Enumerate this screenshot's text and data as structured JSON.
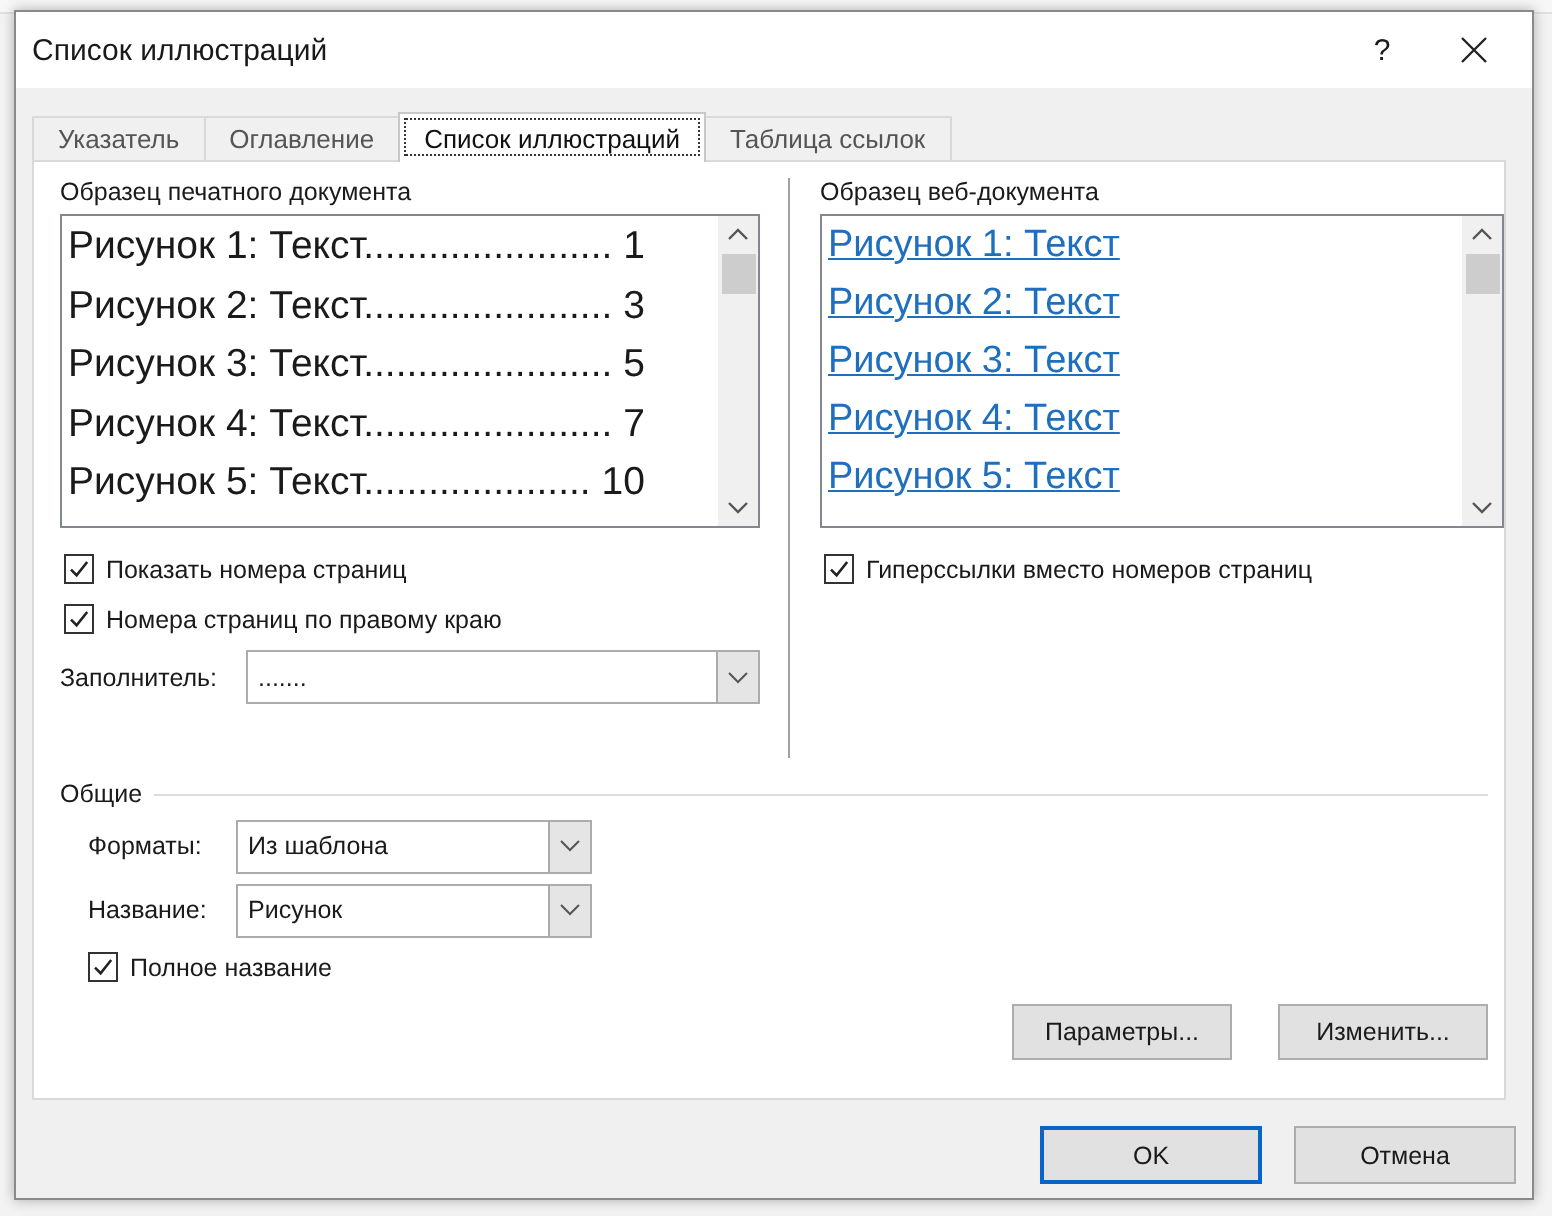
{
  "window": {
    "title": "Список иллюстраций",
    "help": "?"
  },
  "tabs": [
    {
      "label": "Указатель",
      "selected": false
    },
    {
      "label": "Оглавление",
      "selected": false
    },
    {
      "label": "Список иллюстраций",
      "selected": true
    },
    {
      "label": "Таблица ссылок",
      "selected": false
    }
  ],
  "print_preview": {
    "label": "Образец печатного документа",
    "lines": [
      "Рисунок 1: Текст....................... 1",
      "Рисунок 2: Текст....................... 3",
      "Рисунок 3: Текст....................... 5",
      "Рисунок 4: Текст....................... 7",
      "Рисунок 5: Текст..................... 10"
    ]
  },
  "print_options": [
    {
      "label": "Показать номера страниц",
      "checked": true
    },
    {
      "label": "Номера страниц по правому краю",
      "checked": true
    }
  ],
  "leader": {
    "label": "Заполнитель:",
    "value": "......."
  },
  "web_preview": {
    "label": "Образец веб-документа",
    "lines": [
      "Рисунок 1: Текст",
      "Рисунок 2: Текст",
      "Рисунок 3: Текст",
      "Рисунок 4: Текст",
      "Рисунок 5: Текст"
    ]
  },
  "web_option": {
    "label": "Гиперссылки вместо номеров страниц",
    "checked": true
  },
  "general": {
    "title": "Общие",
    "fields": [
      {
        "label": "Форматы:",
        "value": "Из шаблона"
      },
      {
        "label": "Название:",
        "value": "Рисунок"
      }
    ],
    "full_caption": {
      "label": "Полное название",
      "checked": true
    }
  },
  "panel_buttons": [
    "Параметры...",
    "Изменить..."
  ],
  "footer_buttons": [
    {
      "label": "OK",
      "default": true
    },
    {
      "label": "Отмена",
      "default": false
    }
  ]
}
